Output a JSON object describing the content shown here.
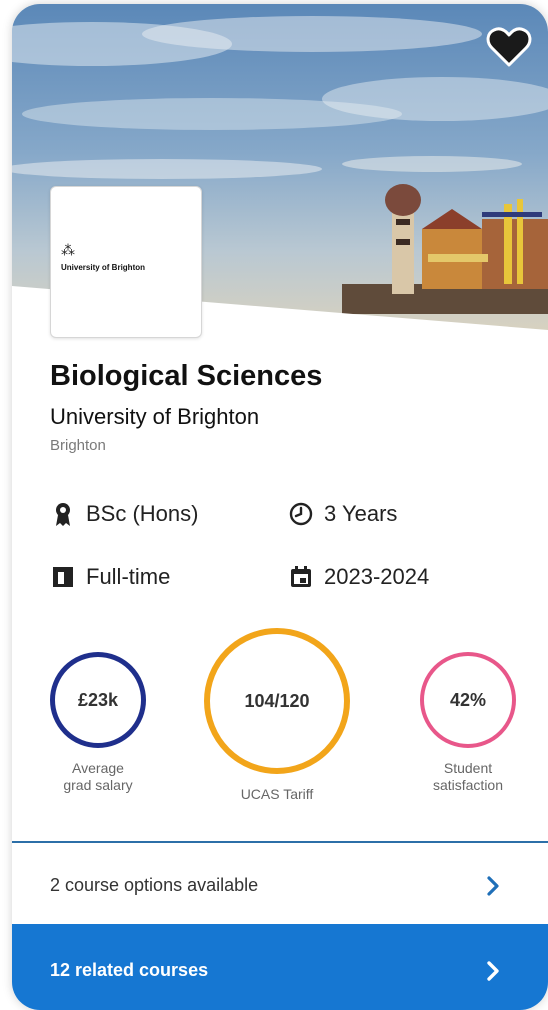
{
  "card": {
    "favorite_icon": "heart-icon",
    "institution_logo": {
      "mark": "⁂",
      "text": "University of Brighton"
    },
    "course_title": "Biological Sciences",
    "university": "University of Brighton",
    "location": "Brighton",
    "facts": {
      "qualification": {
        "icon": "award-ribbon-icon",
        "label": "BSc (Hons)"
      },
      "duration": {
        "icon": "clock-icon",
        "label": "3 Years"
      },
      "study_mode": {
        "icon": "book-icon",
        "label": "Full-time"
      },
      "year": {
        "icon": "calendar-icon",
        "label": "2023-2024"
      }
    },
    "stats": {
      "salary": {
        "value": "£23k",
        "label_line1": "Average",
        "label_line2": "grad salary",
        "color": "#1f2f8c"
      },
      "tariff": {
        "value": "104/120",
        "label_line1": "UCAS Tariff",
        "color": "#f2a51a"
      },
      "satisfaction": {
        "value": "42%",
        "label_line1": "Student",
        "label_line2": "satisfaction",
        "color": "#e8578a"
      }
    },
    "course_options": {
      "label": "2 course options available",
      "icon": "chevron-right-icon"
    },
    "related_courses": {
      "label": "12 related courses",
      "icon": "chevron-right-icon"
    },
    "colors": {
      "accent": "#1677d2",
      "divider": "#2c6fa8"
    }
  }
}
